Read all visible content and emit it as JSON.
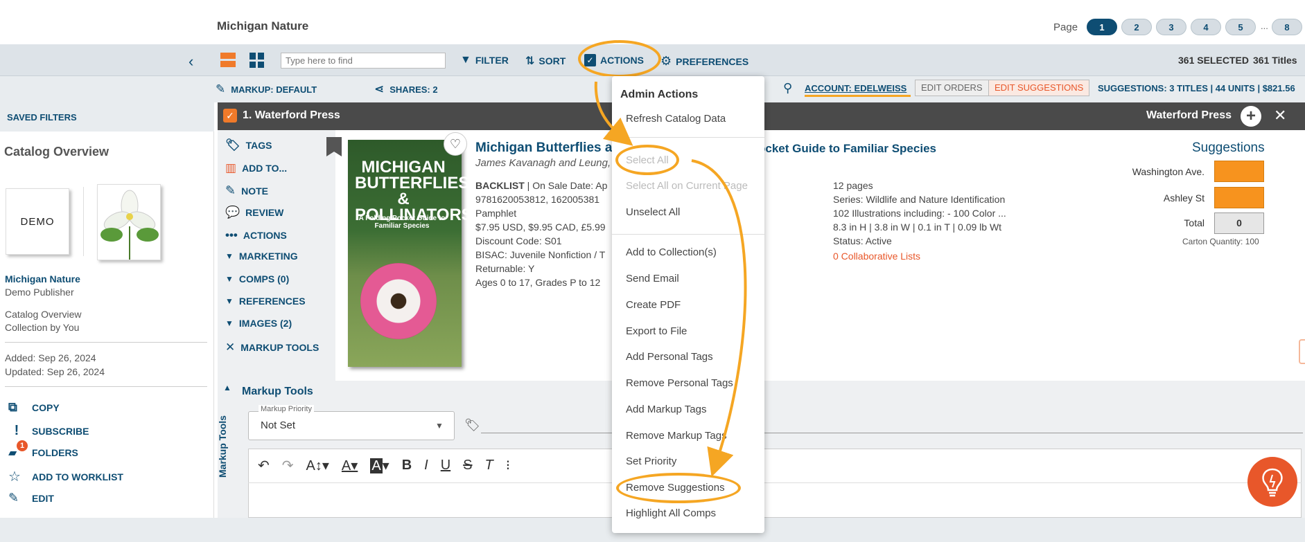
{
  "header": {
    "catalog_title": "Michigan Nature",
    "page_label": "Page",
    "pages": [
      "1",
      "2",
      "3",
      "4",
      "5",
      "8"
    ],
    "page_dots": "..."
  },
  "toolbar": {
    "search_placeholder": "Type here to find",
    "filter": "FILTER",
    "sort": "SORT",
    "actions": "ACTIONS",
    "preferences": "PREFERENCES",
    "selected": "361 SELECTED",
    "titles": "361 Titles"
  },
  "subbar": {
    "markup": "MARKUP: DEFAULT",
    "shares": "SHARES: 2",
    "account": "ACCOUNT: EDELWEISS",
    "edit_orders": "EDIT ORDERS",
    "edit_suggestions": "EDIT SUGGESTIONS",
    "suggestions_summary": "SUGGESTIONS: 3 TITLES | 44 UNITS | $821.56"
  },
  "left": {
    "saved_filters": "SAVED FILTERS",
    "catalog_overview": "Catalog Overview",
    "logo_text": "DEMO",
    "name": "Michigan Nature",
    "publisher": "Demo Publisher",
    "line1": "Catalog Overview",
    "line2": "Collection by You",
    "added": "Added: Sep 26, 2024",
    "updated": "Updated: Sep 26, 2024",
    "links": [
      "COPY",
      "SUBSCRIBE",
      "FOLDERS",
      "ADD TO WORKLIST",
      "EDIT"
    ],
    "folders_badge": "1"
  },
  "titlebar": {
    "title": "1. Waterford Press",
    "publisher": "Waterford Press"
  },
  "sidetools": [
    "TAGS",
    "ADD TO...",
    "NOTE",
    "REVIEW",
    "ACTIONS",
    "MARKETING",
    "COMPS (0)",
    "REFERENCES",
    "IMAGES (2)",
    "MARKUP TOOLS"
  ],
  "book": {
    "cover_title": "MICHIGAN BUTTERFLIES & POLLINATORS",
    "cover_sub": "A Folding Pocket Guide to Familiar Species",
    "title_start": "Michigan Butterflies a",
    "title_end": "ocket Guide to Familiar Species",
    "authors": "James Kavanagh and Leung,",
    "status_prefix": "BACKLIST",
    "status_rest": " | On Sale Date: Ap",
    "isbn": "9781620053812, 162005381",
    "format": "Pamphlet",
    "price": "$7.95 USD, $9.95 CAD, £5.99",
    "discount": "Discount Code: S01",
    "bisac": "BISAC: Juvenile Nonfiction / T",
    "returnable": "Returnable: Y",
    "ages": "Ages 0 to 17, Grades P to 12",
    "pages": "12 pages",
    "series": "Series: Wildlife and Nature Identification",
    "illustrations": "102 Illustrations including: - 100 Color ...",
    "dimensions": "8.3 in H | 3.8 in W | 0.1 in T | 0.09 lb Wt",
    "status": "Status: Active",
    "collab": "0 Collaborative Lists"
  },
  "suggestions": {
    "title": "Suggestions",
    "rows": [
      "Washington Ave.",
      "Ashley St",
      "Total"
    ],
    "total_value": "0",
    "carton": "Carton Quantity: 100"
  },
  "markup_tools": {
    "label": "Markup Tools",
    "vertical": "Markup Tools",
    "priority_legend": "Markup Priority",
    "priority_value": "Not Set"
  },
  "menu": {
    "header": "Admin Actions",
    "items": [
      "Refresh Catalog Data",
      "Select All",
      "Select All on Current Page",
      "Unselect All",
      "Add to Collection(s)",
      "Send Email",
      "Create PDF",
      "Export to File",
      "Add Personal Tags",
      "Remove Personal Tags",
      "Add Markup Tags",
      "Remove Markup Tags",
      "Set Priority",
      "Remove Suggestions",
      "Highlight All Comps"
    ]
  },
  "colors": {
    "accent": "#f5a623",
    "brand": "#0e4d73",
    "orange": "#f7931e"
  }
}
